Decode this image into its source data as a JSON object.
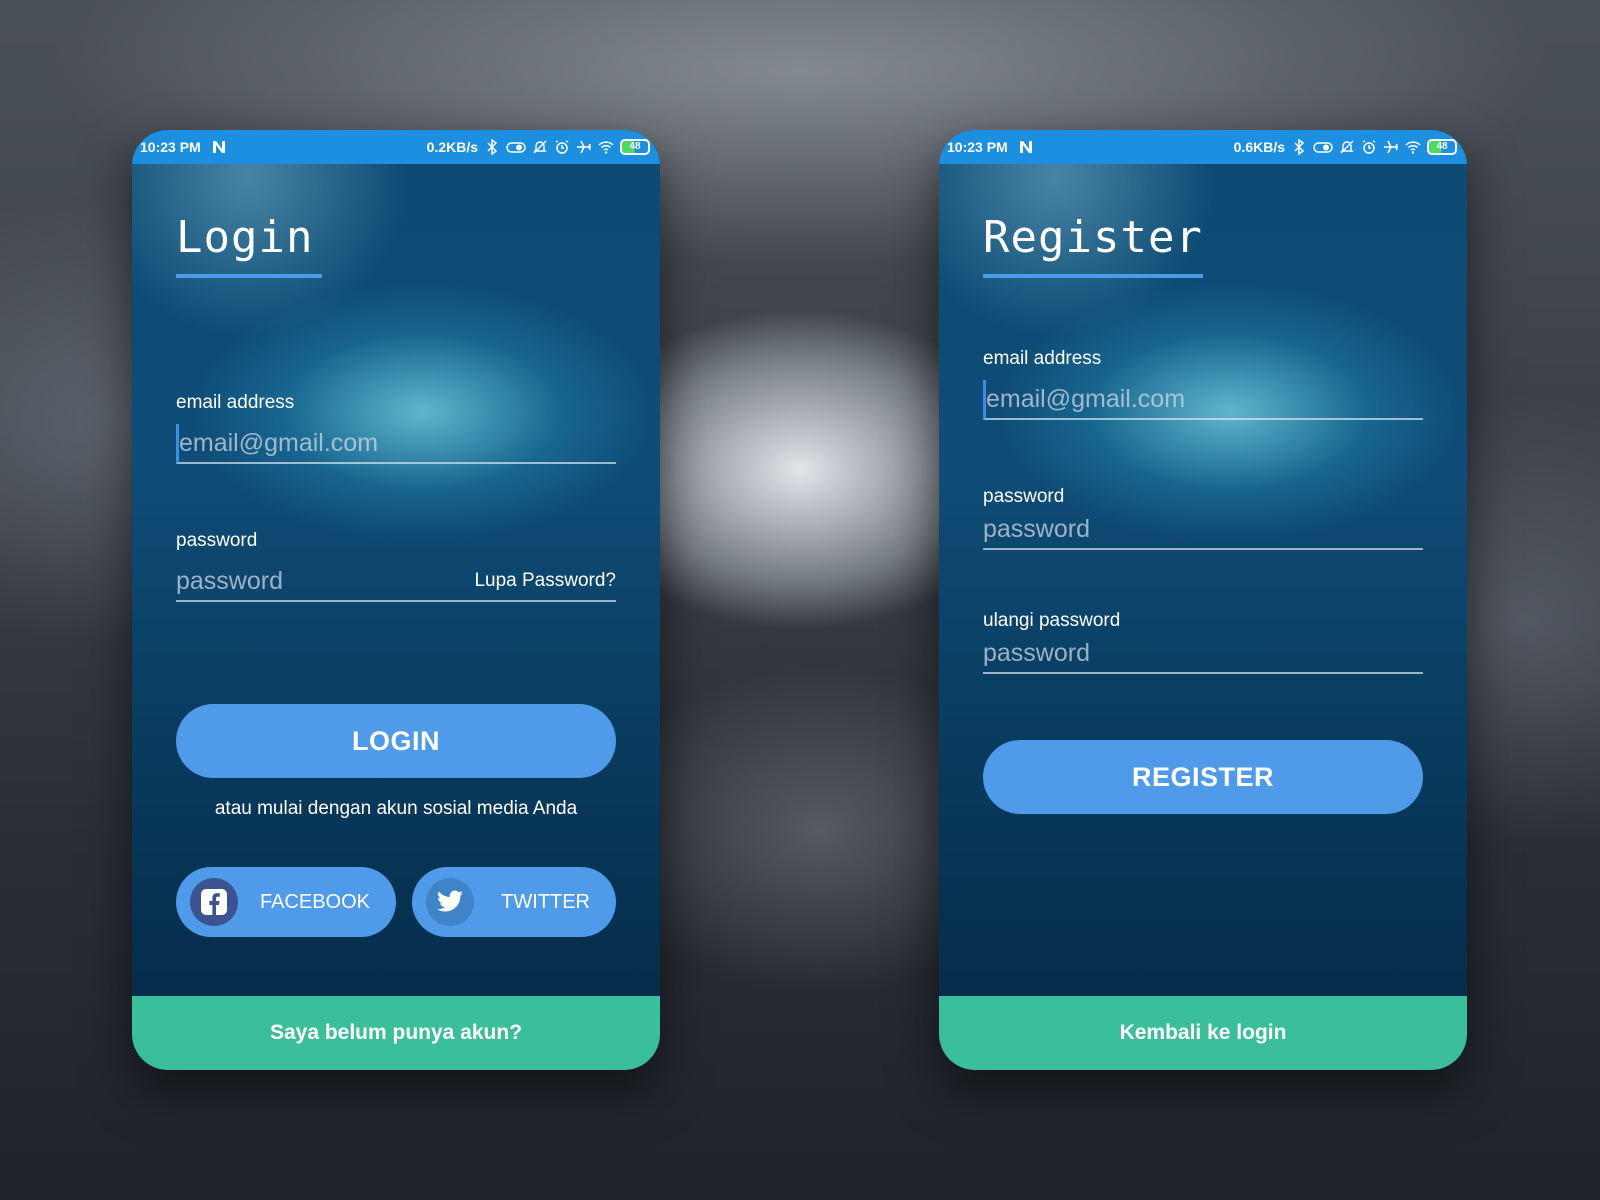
{
  "colors": {
    "status_bar": "#1d8fe0",
    "accent_underline": "#4c9be8",
    "button": "#4f9ae9",
    "footer": "#3bbf9b"
  },
  "login_screen": {
    "status": {
      "time": "10:23 PM",
      "speed": "0.2KB/s",
      "battery": "48"
    },
    "title": "Login",
    "email": {
      "label": "email address",
      "placeholder": "email@gmail.com"
    },
    "password": {
      "label": "password",
      "placeholder": "password",
      "forgot_link": "Lupa Password?"
    },
    "login_button": "LOGIN",
    "social_prompt": "atau mulai dengan akun sosial media Anda",
    "facebook_button": {
      "label": "FACEBOOK",
      "icon": "facebook-icon"
    },
    "twitter_button": {
      "label": "TWITTER",
      "icon": "twitter-icon"
    },
    "footer_link": "Saya belum punya akun?"
  },
  "register_screen": {
    "status": {
      "time": "10:23 PM",
      "speed": "0.6KB/s",
      "battery": "48"
    },
    "title": "Register",
    "email": {
      "label": "email address",
      "placeholder": "email@gmail.com"
    },
    "password": {
      "label": "password",
      "placeholder": "password"
    },
    "repeat_password": {
      "label": "ulangi password",
      "placeholder": "password"
    },
    "register_button": "REGISTER",
    "footer_link": "Kembali ke login"
  }
}
